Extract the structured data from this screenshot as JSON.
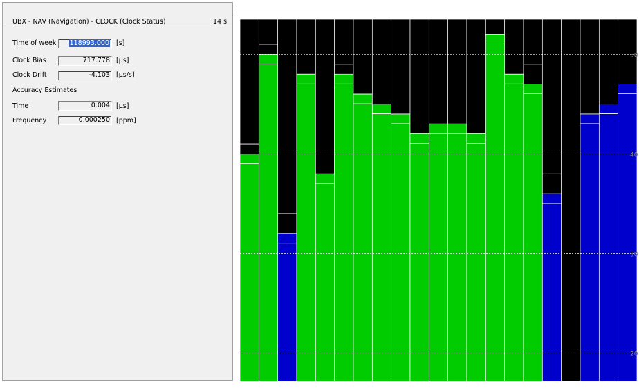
{
  "panel": {
    "title": "UBX - NAV (Navigation) - CLOCK (Clock Status)",
    "age": "14 s",
    "rows": {
      "time_of_week": {
        "label": "Time of week",
        "value": "118993.000",
        "unit": "[s]"
      },
      "clock_bias": {
        "label": "Clock Bias",
        "value": "717.778",
        "unit": "[µs]"
      },
      "clock_drift": {
        "label": "Clock Drift",
        "value": "-4.103",
        "unit": "[µs/s]"
      },
      "accuracy_heading": "Accuracy Estimates",
      "time": {
        "label": "Time",
        "value": "0.004",
        "unit": "[µs]"
      },
      "frequency": {
        "label": "Frequency",
        "value": "0.000250",
        "unit": "[ppm]"
      }
    }
  },
  "colors": {
    "green": "#00cc00",
    "blue": "#0000cc",
    "background": "#000000",
    "grid": "#ffffff"
  },
  "chart_data": {
    "type": "bar",
    "y_ticks": [
      "50",
      "40",
      "30",
      "20"
    ],
    "ylim": [
      16.5,
      53.5
    ],
    "grid": true,
    "bars": [
      {
        "value": 40.0,
        "color": "green",
        "marker": 41.0
      },
      {
        "value": 50.0,
        "color": "green",
        "marker": 51.0
      },
      {
        "value": 32.0,
        "color": "blue",
        "marker": 34.0
      },
      {
        "value": 48.0,
        "color": "green",
        "marker": 48.0
      },
      {
        "value": 38.0,
        "color": "green",
        "marker": 38.0
      },
      {
        "value": 48.0,
        "color": "green",
        "marker": 49.0
      },
      {
        "value": 46.0,
        "color": "green",
        "marker": 46.0
      },
      {
        "value": 45.0,
        "color": "green",
        "marker": 45.0
      },
      {
        "value": 44.0,
        "color": "green",
        "marker": 44.0
      },
      {
        "value": 42.0,
        "color": "green",
        "marker": 42.0
      },
      {
        "value": 43.0,
        "color": "green",
        "marker": 43.0
      },
      {
        "value": 43.0,
        "color": "green",
        "marker": 43.0
      },
      {
        "value": 42.0,
        "color": "green",
        "marker": 42.0
      },
      {
        "value": 52.0,
        "color": "green",
        "marker": 52.0
      },
      {
        "value": 48.0,
        "color": "green",
        "marker": 48.0
      },
      {
        "value": 47.0,
        "color": "green",
        "marker": 49.0
      },
      {
        "value": 36.0,
        "color": "blue",
        "marker": 38.0
      },
      {
        "value": 0.0,
        "color": "none",
        "marker": null
      },
      {
        "value": 44.0,
        "color": "blue",
        "marker": 44.0
      },
      {
        "value": 45.0,
        "color": "blue",
        "marker": 45.0
      },
      {
        "value": 47.0,
        "color": "blue",
        "marker": 47.0
      }
    ]
  }
}
